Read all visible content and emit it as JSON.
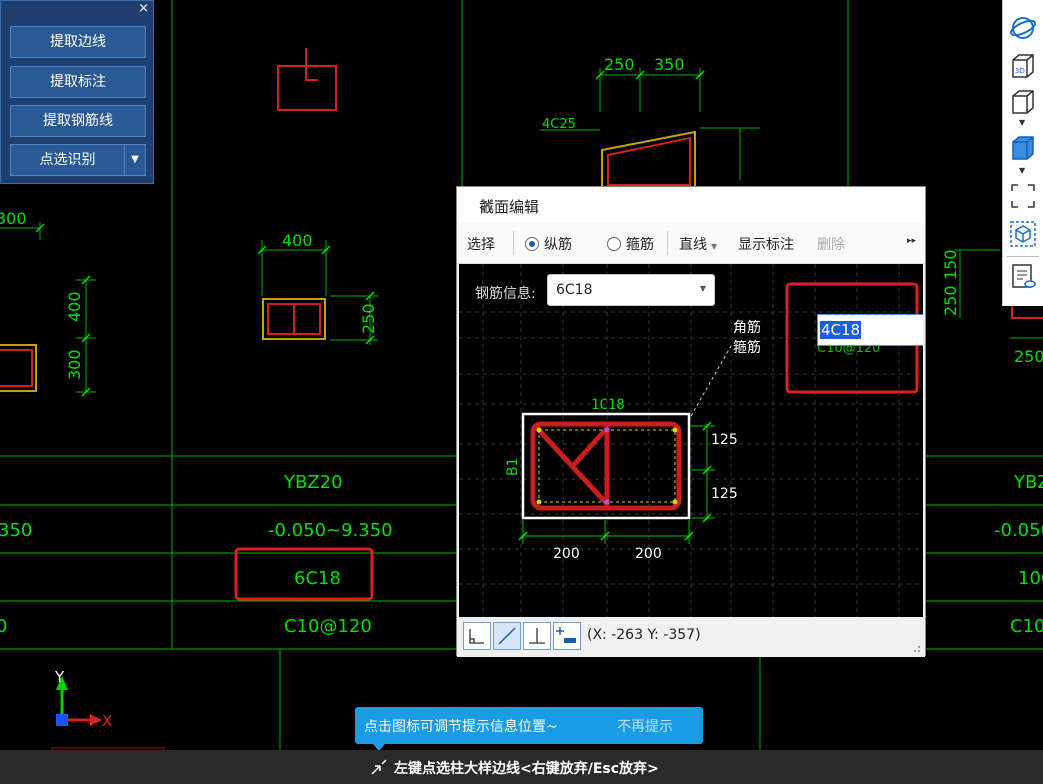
{
  "left_panel": {
    "buttons": [
      "提取边线",
      "提取标注",
      "提取钢筋线",
      "点选识别"
    ],
    "close": "×"
  },
  "drawing": {
    "dims_top": [
      "250",
      "350"
    ],
    "dim_left_top": "300",
    "dim_left_400": "400",
    "dim_left_300": "300",
    "dim_400": "400",
    "dim_250": "250",
    "rebar_4c25": "4C25",
    "dims_right": [
      "250",
      "150"
    ],
    "dim_right_250": "250",
    "table": {
      "name_center": "YBZ20",
      "name_right": "YBZ",
      "elev_left": "350",
      "elev_center": "-0.050~9.350",
      "elev_right": "-0.050~",
      "rebar_center": "6C18",
      "rebar_right": "10C",
      "stirrup_left": "0",
      "stirrup_center": "C10@120",
      "stirrup_right": "C10@"
    },
    "axis": {
      "y": "Y",
      "x": "X"
    }
  },
  "dialog": {
    "title": "截面编辑",
    "close": "✕",
    "toolbar": {
      "select": "选择",
      "longitudinal": "纵筋",
      "stirrup": "箍筋",
      "line": "直线",
      "show_dim": "显示标注",
      "delete": "删除",
      "more": "▸▸"
    },
    "rebar_info_label": "钢筋信息:",
    "rebar_info_value": "6C18",
    "edit_value": "4C18",
    "legend_corner": "角筋",
    "legend_stirrup": "箍筋",
    "stirrup_ghost": "C10@120",
    "section": {
      "label_top": "1C18",
      "label_side": "B1",
      "dim_v1": "125",
      "dim_v2": "125",
      "dim_h1": "200",
      "dim_h2": "200"
    },
    "coords": "(X: -263 Y: -357)"
  },
  "tooltip": {
    "text": "点击图标可调节提示信息位置~",
    "dismiss": "不再提示"
  },
  "status": "左键点选柱大样边线<右键放弃/Esc放弃>",
  "colors": {
    "line": "#00c000",
    "text": "#00e000",
    "rebar": "#c81e1e",
    "accent": "#1a9be6"
  }
}
